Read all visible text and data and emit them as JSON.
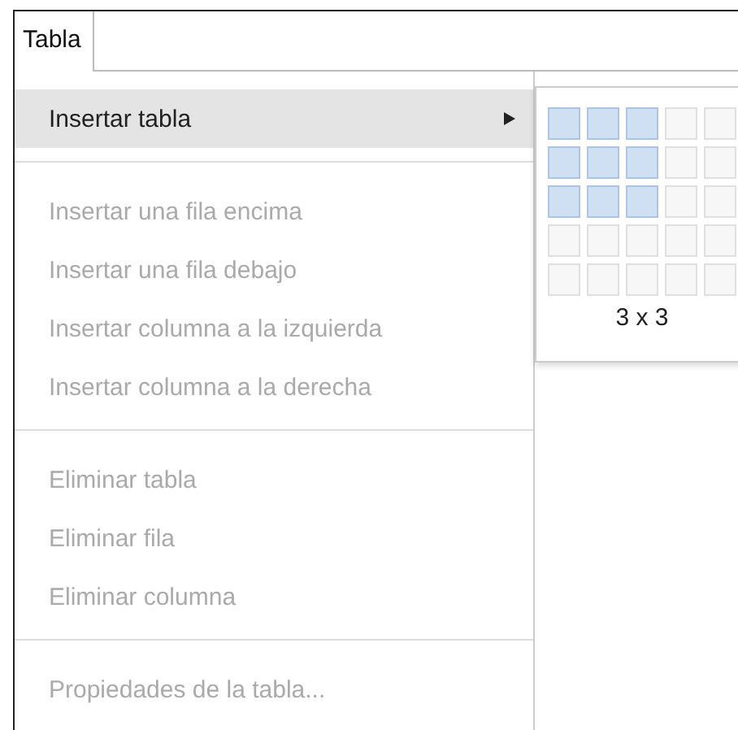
{
  "menu_bar": {
    "tabs": [
      {
        "label": "Tabla",
        "selected": true
      }
    ]
  },
  "menu": {
    "items": [
      {
        "kind": "item",
        "label": "Insertar tabla",
        "selected": true,
        "disabled": false,
        "has_submenu": true
      },
      {
        "kind": "separator"
      },
      {
        "kind": "item",
        "label": "Insertar una fila encima",
        "selected": false,
        "disabled": true,
        "has_submenu": false
      },
      {
        "kind": "item",
        "label": "Insertar una fila debajo",
        "selected": false,
        "disabled": true,
        "has_submenu": false
      },
      {
        "kind": "item",
        "label": "Insertar columna a la izquierda",
        "selected": false,
        "disabled": true,
        "has_submenu": false
      },
      {
        "kind": "item",
        "label": "Insertar columna a la derecha",
        "selected": false,
        "disabled": true,
        "has_submenu": false
      },
      {
        "kind": "separator"
      },
      {
        "kind": "item",
        "label": "Eliminar tabla",
        "selected": false,
        "disabled": true,
        "has_submenu": false
      },
      {
        "kind": "item",
        "label": "Eliminar fila",
        "selected": false,
        "disabled": true,
        "has_submenu": false
      },
      {
        "kind": "item",
        "label": "Eliminar columna",
        "selected": false,
        "disabled": true,
        "has_submenu": false
      },
      {
        "kind": "separator"
      },
      {
        "kind": "item",
        "label": "Propiedades de la tabla...",
        "selected": false,
        "disabled": true,
        "has_submenu": false
      }
    ]
  },
  "table_size_picker": {
    "rows": [
      [
        {
          "selected": true
        },
        {
          "selected": true
        },
        {
          "selected": true
        },
        {
          "selected": false
        },
        {
          "selected": false
        }
      ],
      [
        {
          "selected": true
        },
        {
          "selected": true
        },
        {
          "selected": true
        },
        {
          "selected": false
        },
        {
          "selected": false
        }
      ],
      [
        {
          "selected": true
        },
        {
          "selected": true
        },
        {
          "selected": true
        },
        {
          "selected": false
        },
        {
          "selected": false
        }
      ],
      [
        {
          "selected": false
        },
        {
          "selected": false
        },
        {
          "selected": false
        },
        {
          "selected": false
        },
        {
          "selected": false
        }
      ],
      [
        {
          "selected": false
        },
        {
          "selected": false
        },
        {
          "selected": false
        },
        {
          "selected": false
        },
        {
          "selected": false
        }
      ]
    ],
    "size_label": "3 x 3"
  }
}
